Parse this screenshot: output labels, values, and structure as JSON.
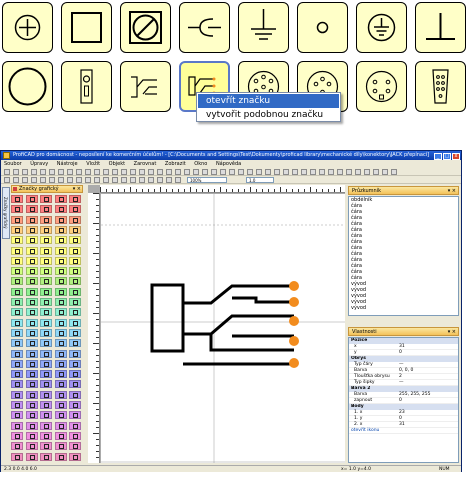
{
  "context_menu": {
    "items": [
      "otevřít značku",
      "vytvořit podobnou značku"
    ]
  },
  "palette": {
    "icons": [
      "switch-plus-icon",
      "square-icon",
      "forbidden-square-icon",
      "capacitor-fork-icon",
      "ground-icon",
      "circle-terminal-icon",
      "earth-ground-circle-icon",
      "inverted-t-icon",
      "large-circle-icon",
      "keyhole-connector-icon",
      "connector-outline-icon",
      "jack-connector-icon",
      "din-socket-icon",
      "round-socket-icon",
      "mini-din-icon",
      "d-sub-icon"
    ]
  },
  "window": {
    "title": "ProfiCAD pro domácnost - neposílení ke komerčním účelům! - [C:\\Documents and Settings\\Test\\Dokumenty\\proficad library\\mechanické díly\\konektory\\JACK přepínací]"
  },
  "menu": [
    "Soubor",
    "Úpravy",
    "Nástroje",
    "Vložit",
    "Objekt",
    "Zarovnat",
    "Zobrazit",
    "Okno",
    "Nápověda"
  ],
  "toolbar": {
    "zoom": "100%",
    "line_width": "1.0"
  },
  "left_panel": {
    "title": "Značky grafický",
    "tab_label": "Značky grafický"
  },
  "explorer": {
    "title": "Průzkumník",
    "items": [
      "obdélník",
      "čára",
      "čára",
      "čára",
      "čára",
      "čára",
      "čára",
      "čára",
      "čára",
      "čára",
      "čára",
      "čára",
      "čára",
      "čára",
      "vývod",
      "vývod",
      "vývod",
      "vývod",
      "vývod"
    ]
  },
  "properties": {
    "title": "Vlastnosti",
    "groups": [
      {
        "name": "Pozice",
        "rows": [
          {
            "k": "x",
            "v": "31"
          },
          {
            "k": "y",
            "v": "0"
          }
        ]
      },
      {
        "name": "Obrys",
        "rows": [
          {
            "k": "Typ čáry",
            "v": "—"
          },
          {
            "k": "Barva",
            "v": "0, 0, 0"
          },
          {
            "k": "Tloušťka obrysu",
            "v": "2"
          },
          {
            "k": "Typ šipky",
            "v": "—"
          }
        ]
      },
      {
        "name": "Barva 2",
        "rows": [
          {
            "k": "Barva",
            "v": "255, 255, 255"
          },
          {
            "k": "zapnout",
            "v": "0"
          }
        ]
      },
      {
        "name": "Body",
        "rows": [
          {
            "k": "1. x",
            "v": "23"
          },
          {
            "k": "1. y",
            "v": "0"
          },
          {
            "k": "2. x",
            "v": "31"
          }
        ]
      }
    ],
    "footer_link": "otevřít ikonu"
  },
  "status": {
    "coords_left": "2.3  0.0  4.0  6.0",
    "coords_mid": "x= 1.0  y=4.0",
    "mode": "NUM"
  },
  "colors": {
    "tile_bg": "#ffffc8",
    "pin_color": "#f28c1e",
    "title_blue": "#2563d9",
    "highlight": "#316ac5"
  }
}
